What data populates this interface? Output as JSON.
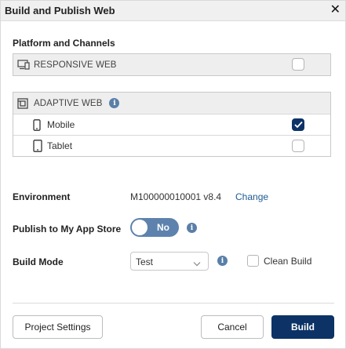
{
  "dialog": {
    "title": "Build and Publish Web",
    "close_glyph": "✕"
  },
  "platform": {
    "section_label": "Platform and Channels",
    "responsive": {
      "label": "RESPONSIVE WEB",
      "icon": "monitor-icon",
      "checked": false
    },
    "adaptive": {
      "label": "ADAPTIVE WEB",
      "icon": "adaptive-layout-icon",
      "channels": [
        {
          "label": "Mobile",
          "icon": "mobile-phone-icon",
          "checked": true
        },
        {
          "label": "Tablet",
          "icon": "tablet-icon",
          "checked": false
        }
      ]
    }
  },
  "environment": {
    "label": "Environment",
    "value": "M100000010001 v8.4",
    "change_link": "Change"
  },
  "publish": {
    "label": "Publish to My App Store",
    "toggle_text": "No",
    "on": false
  },
  "build_mode": {
    "label": "Build Mode",
    "selected": "Test",
    "clean_build_label": "Clean Build",
    "clean_build_checked": false
  },
  "footer": {
    "project_settings": "Project Settings",
    "cancel": "Cancel",
    "build": "Build"
  },
  "colors": {
    "primary": "#0d3366",
    "toggle": "#5d82ad",
    "link": "#1d5a93",
    "info": "#5a7fa8"
  }
}
